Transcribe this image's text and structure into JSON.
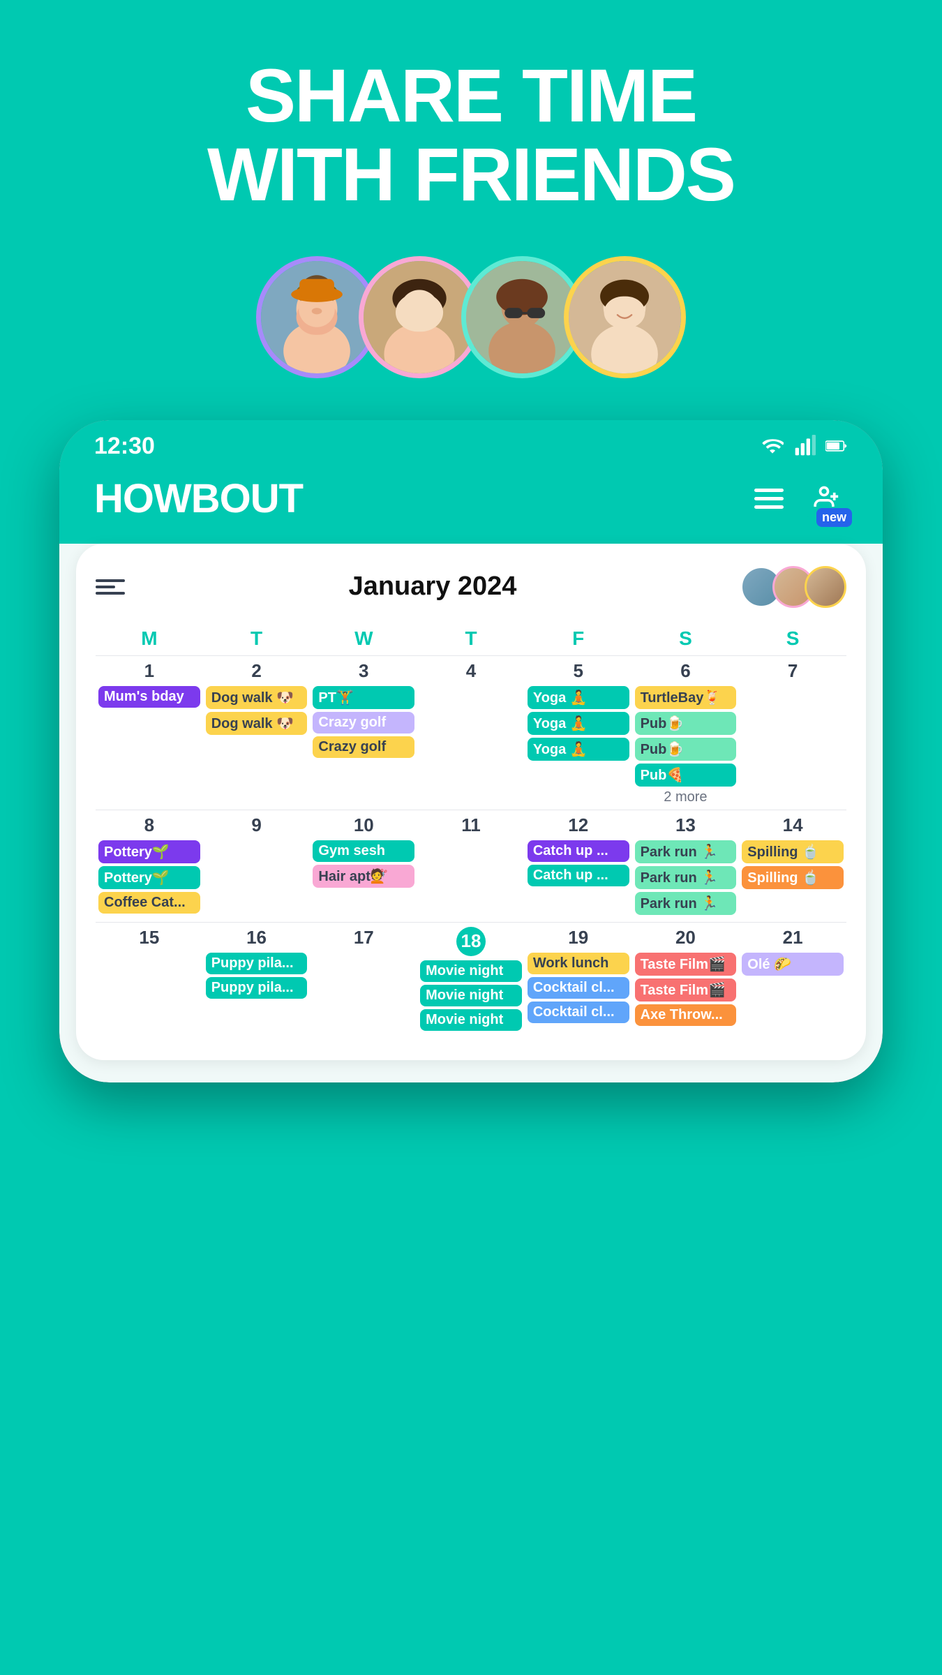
{
  "hero": {
    "title_line1": "SHARE TIME",
    "title_line2": "WITH FRIENDS"
  },
  "status_bar": {
    "time": "12:30",
    "wifi": "wifi-icon",
    "signal": "signal-icon",
    "battery": "battery-icon"
  },
  "app": {
    "logo": "HOWBOUT",
    "hamburger": "menu-icon",
    "add_friend": "+",
    "new_badge": "new"
  },
  "calendar": {
    "month": "January 2024",
    "filter_label": "filter",
    "day_headers": [
      "M",
      "T",
      "W",
      "T",
      "F",
      "S",
      "S"
    ],
    "weeks": [
      {
        "days": [
          {
            "date": "1",
            "today": false,
            "events": [
              {
                "label": "Mum's bday",
                "color": "purple"
              }
            ]
          },
          {
            "date": "2",
            "today": false,
            "events": [
              {
                "label": "Dog walk 🐶",
                "color": "yellow"
              },
              {
                "label": "Dog walk 🐶",
                "color": "yellow"
              }
            ]
          },
          {
            "date": "3",
            "today": false,
            "events": [
              {
                "label": "PT🏋",
                "color": "teal"
              },
              {
                "label": "Crazy golf",
                "color": "light-purple"
              },
              {
                "label": "Crazy golf",
                "color": "yellow"
              }
            ]
          },
          {
            "date": "4",
            "today": false,
            "events": []
          },
          {
            "date": "5",
            "today": false,
            "events": [
              {
                "label": "Yoga 🧘",
                "color": "teal"
              },
              {
                "label": "Yoga 🧘",
                "color": "teal"
              },
              {
                "label": "Yoga 🧘",
                "color": "teal"
              }
            ]
          },
          {
            "date": "6",
            "today": false,
            "events": [
              {
                "label": "TurtleBay🍹",
                "color": "yellow"
              },
              {
                "label": "Pub🍺",
                "color": "green"
              },
              {
                "label": "Pub🍺",
                "color": "green"
              },
              {
                "label": "Pub🍕",
                "color": "teal"
              },
              {
                "more": "2 more"
              }
            ]
          },
          {
            "date": "7",
            "today": false,
            "events": []
          }
        ]
      },
      {
        "days": [
          {
            "date": "8",
            "today": false,
            "events": [
              {
                "label": "Pottery🌱",
                "color": "purple"
              },
              {
                "label": "Pottery🌱",
                "color": "teal"
              },
              {
                "label": "Coffee Cat...",
                "color": "yellow"
              }
            ]
          },
          {
            "date": "9",
            "today": false,
            "events": []
          },
          {
            "date": "10",
            "today": false,
            "events": [
              {
                "label": "Gym sesh",
                "color": "teal"
              },
              {
                "label": "Hair apt💇",
                "color": "pink"
              }
            ]
          },
          {
            "date": "11",
            "today": false,
            "events": []
          },
          {
            "date": "12",
            "today": false,
            "events": [
              {
                "label": "Catch up ...",
                "color": "purple"
              },
              {
                "label": "Catch up ...",
                "color": "teal"
              }
            ]
          },
          {
            "date": "13",
            "today": false,
            "events": [
              {
                "label": "Park run 🏃",
                "color": "green"
              },
              {
                "label": "Park run 🏃",
                "color": "green"
              },
              {
                "label": "Park run 🏃",
                "color": "green"
              }
            ]
          },
          {
            "date": "14",
            "today": false,
            "events": [
              {
                "label": "Spilling 🍵",
                "color": "yellow"
              },
              {
                "label": "Spilling 🍵",
                "color": "orange"
              }
            ]
          }
        ]
      },
      {
        "days": [
          {
            "date": "15",
            "today": false,
            "events": []
          },
          {
            "date": "16",
            "today": false,
            "events": [
              {
                "label": "Puppy pila...",
                "color": "teal"
              },
              {
                "label": "Puppy pila...",
                "color": "teal"
              }
            ]
          },
          {
            "date": "17",
            "today": false,
            "events": []
          },
          {
            "date": "18",
            "today": true,
            "events": [
              {
                "label": "Movie night",
                "color": "teal"
              },
              {
                "label": "Movie night",
                "color": "teal"
              },
              {
                "label": "Movie night",
                "color": "teal"
              }
            ]
          },
          {
            "date": "19",
            "today": false,
            "events": [
              {
                "label": "Work lunch",
                "color": "yellow"
              },
              {
                "label": "Cocktail cl...",
                "color": "blue"
              },
              {
                "label": "Cocktail cl...",
                "color": "blue"
              }
            ]
          },
          {
            "date": "20",
            "today": false,
            "events": [
              {
                "label": "Taste Film🎬",
                "color": "red"
              },
              {
                "label": "Taste Film🎬",
                "color": "red"
              },
              {
                "label": "Axe Throw...",
                "color": "orange"
              }
            ]
          },
          {
            "date": "21",
            "today": false,
            "events": [
              {
                "label": "Olé 🌮",
                "color": "light-purple"
              }
            ]
          }
        ]
      }
    ]
  }
}
